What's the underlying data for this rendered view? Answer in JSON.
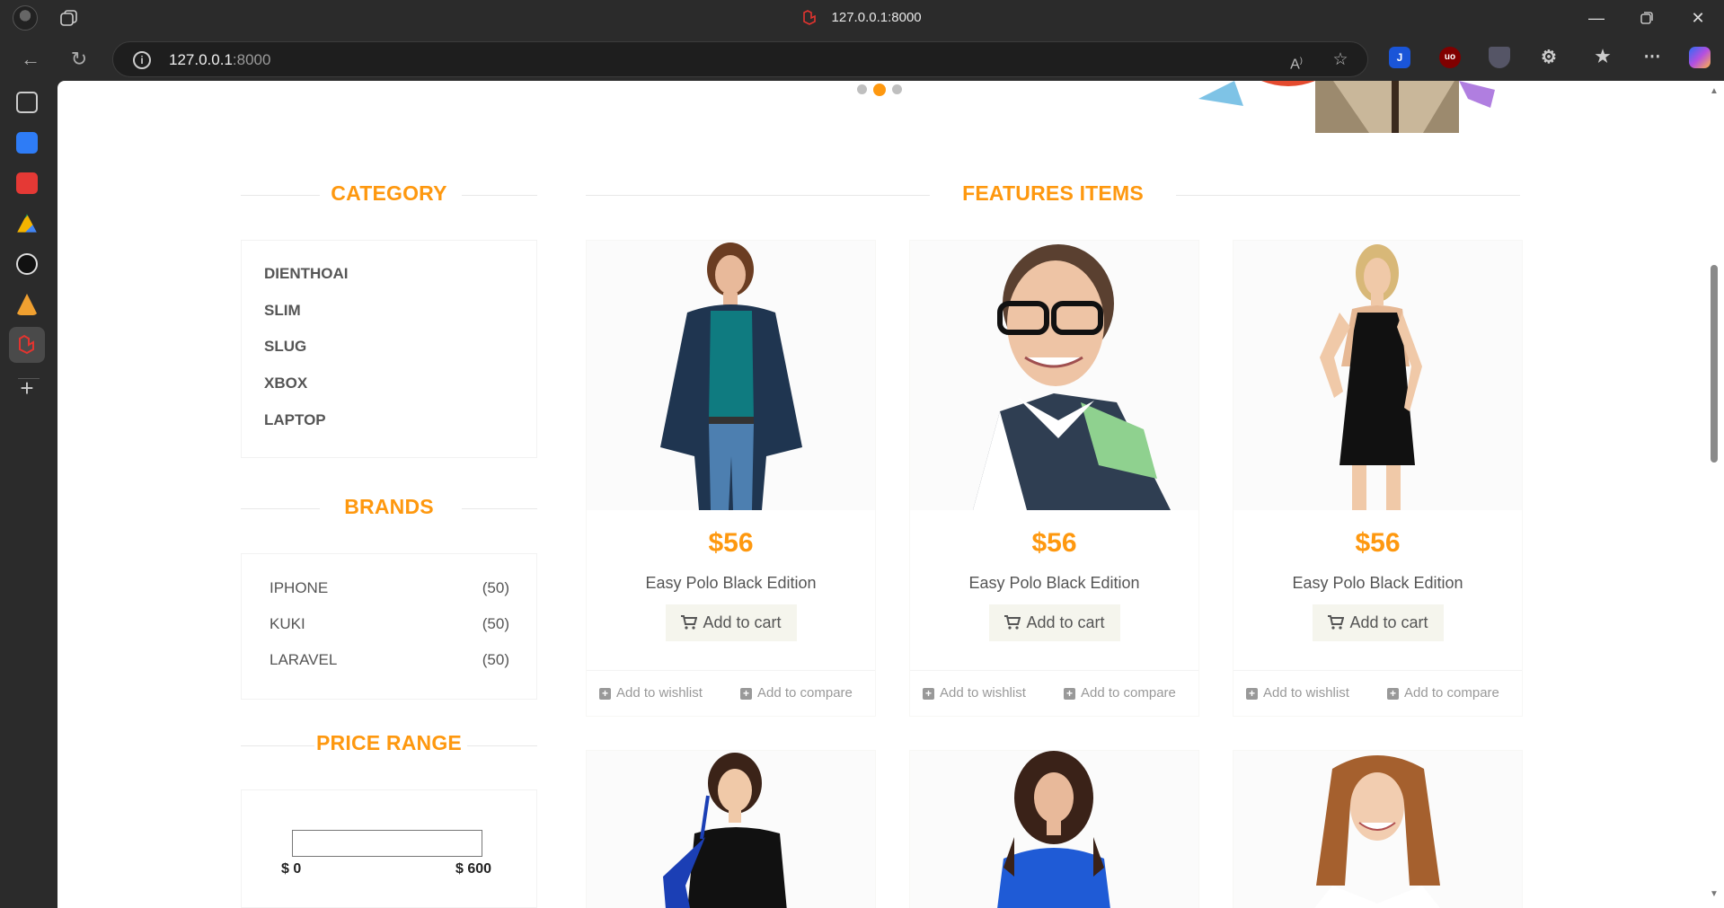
{
  "browser": {
    "tab_title": "127.0.0.1:8000",
    "url_host": "127.0.0.1",
    "url_port": ":8000",
    "icons": [
      "profile-avatar",
      "tab-actions-icon",
      "laravel-icon",
      "minimize-icon",
      "restore-icon",
      "close-icon",
      "back-icon",
      "refresh-icon",
      "info-icon",
      "read-aloud-icon",
      "favorite-star-icon",
      "extensions-icon",
      "favorites-icon",
      "more-icon",
      "copilot-icon"
    ]
  },
  "sidebar": {
    "icons": [
      "vertical-tabs-icon",
      "translate-icon",
      "pdf-icon",
      "google-drive-icon",
      "chatgpt-icon",
      "sourcetree-icon",
      "laravel-app-icon",
      "add-icon"
    ]
  },
  "slider": {
    "dots": 3,
    "active_index": 1
  },
  "category": {
    "title": "CATEGORY",
    "items": [
      "DIENTHOAI",
      "SLIM",
      "SLUG",
      "XBOX",
      "LAPTOP"
    ]
  },
  "brands": {
    "title": "BRANDS",
    "items": [
      {
        "name": "IPHONE",
        "count": "(50)"
      },
      {
        "name": "KUKI",
        "count": "(50)"
      },
      {
        "name": "LARAVEL",
        "count": "(50)"
      }
    ]
  },
  "price_range": {
    "title": "PRICE RANGE",
    "min_label": "$ 0",
    "max_label": "$ 600"
  },
  "features": {
    "title": "FEATURES ITEMS",
    "products": [
      {
        "price": "$56",
        "name": "Easy Polo Black Edition",
        "cart_label": "Add to cart",
        "wishlist_label": "Add to wishlist",
        "compare_label": "Add to compare"
      },
      {
        "price": "$56",
        "name": "Easy Polo Black Edition",
        "cart_label": "Add to cart",
        "wishlist_label": "Add to wishlist",
        "compare_label": "Add to compare"
      },
      {
        "price": "$56",
        "name": "Easy Polo Black Edition",
        "cart_label": "Add to cart",
        "wishlist_label": "Add to wishlist",
        "compare_label": "Add to compare"
      }
    ]
  },
  "colors": {
    "accent": "#FE980F",
    "text": "#555555",
    "browser_chrome": "#2B2B2B"
  }
}
